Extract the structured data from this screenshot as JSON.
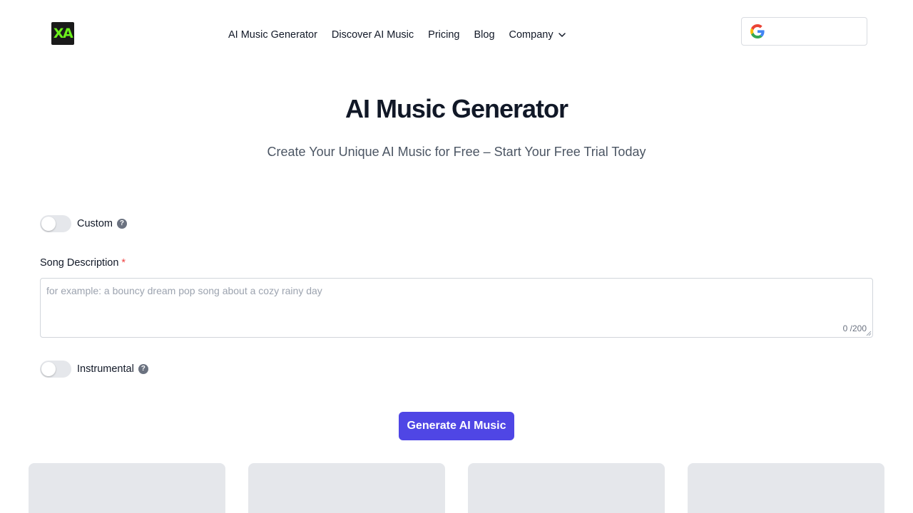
{
  "header": {
    "logo_text": "XA",
    "nav": [
      {
        "label": "AI Music Generator"
      },
      {
        "label": "Discover AI Music"
      },
      {
        "label": "Pricing"
      },
      {
        "label": "Blog"
      },
      {
        "label": "Company"
      }
    ],
    "google_icon": "google-icon"
  },
  "hero": {
    "title": "AI Music Generator",
    "subtitle": "Create Your Unique AI Music for Free – Start Your Free Trial Today"
  },
  "form": {
    "custom_toggle": {
      "label": "Custom",
      "on": false
    },
    "song_description": {
      "label": "Song Description",
      "required_marker": "*",
      "placeholder": "for example: a bouncy dream pop song about a cozy rainy day",
      "value": "",
      "counter": "0 /200"
    },
    "instrumental_toggle": {
      "label": "Instrumental",
      "on": false
    },
    "help_glyph": "?",
    "generate_label": "Generate AI Music"
  },
  "colors": {
    "accent": "#4f46e5",
    "logo_text": "#6cf01c",
    "required": "#ef4444",
    "placeholder_card": "#e5e7eb"
  }
}
